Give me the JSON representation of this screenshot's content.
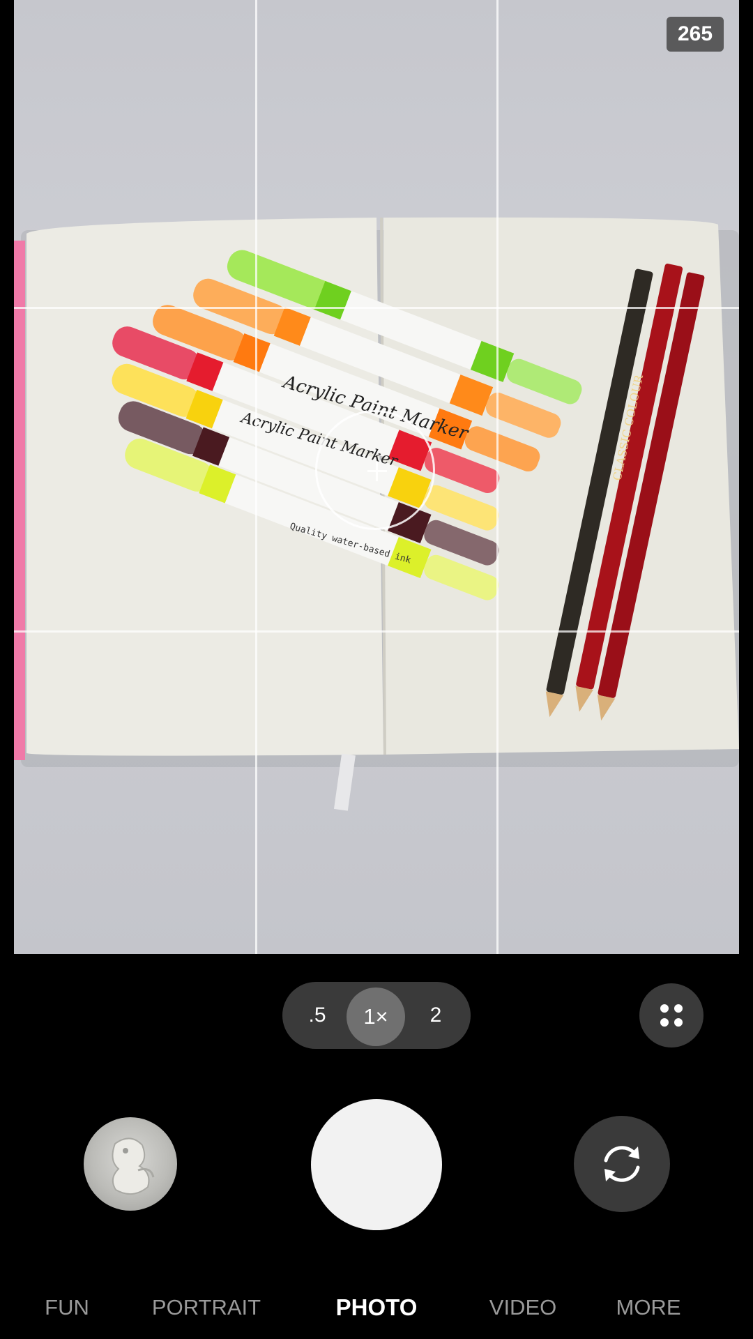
{
  "viewfinder": {
    "frame_counter": "265",
    "scene_text": {
      "marker_brand": "Acrylic Paint Marker",
      "marker_subtext": "Quality water-based ink",
      "pencil_text": "CLASSIC COLOUR"
    }
  },
  "zoom": {
    "options": [
      ".5",
      "1×",
      "2"
    ],
    "selected": "1×"
  },
  "modes": {
    "fun": "FUN",
    "portrait": "PORTRAIT",
    "photo": "PHOTO",
    "video": "VIDEO",
    "more": "MORE",
    "active": "PHOTO"
  },
  "icons": {
    "grid_toggle": "grid-dots-icon",
    "flip_camera": "rotate-camera-icon",
    "gallery": "gallery-thumbnail"
  },
  "colors": {
    "background": "#000000",
    "pill": "#3a3a3a",
    "zoom_selected": "#707070",
    "shutter": "#f2f2f2",
    "inactive_mode": "#9a9a9a",
    "active_mode": "#ffffff"
  }
}
